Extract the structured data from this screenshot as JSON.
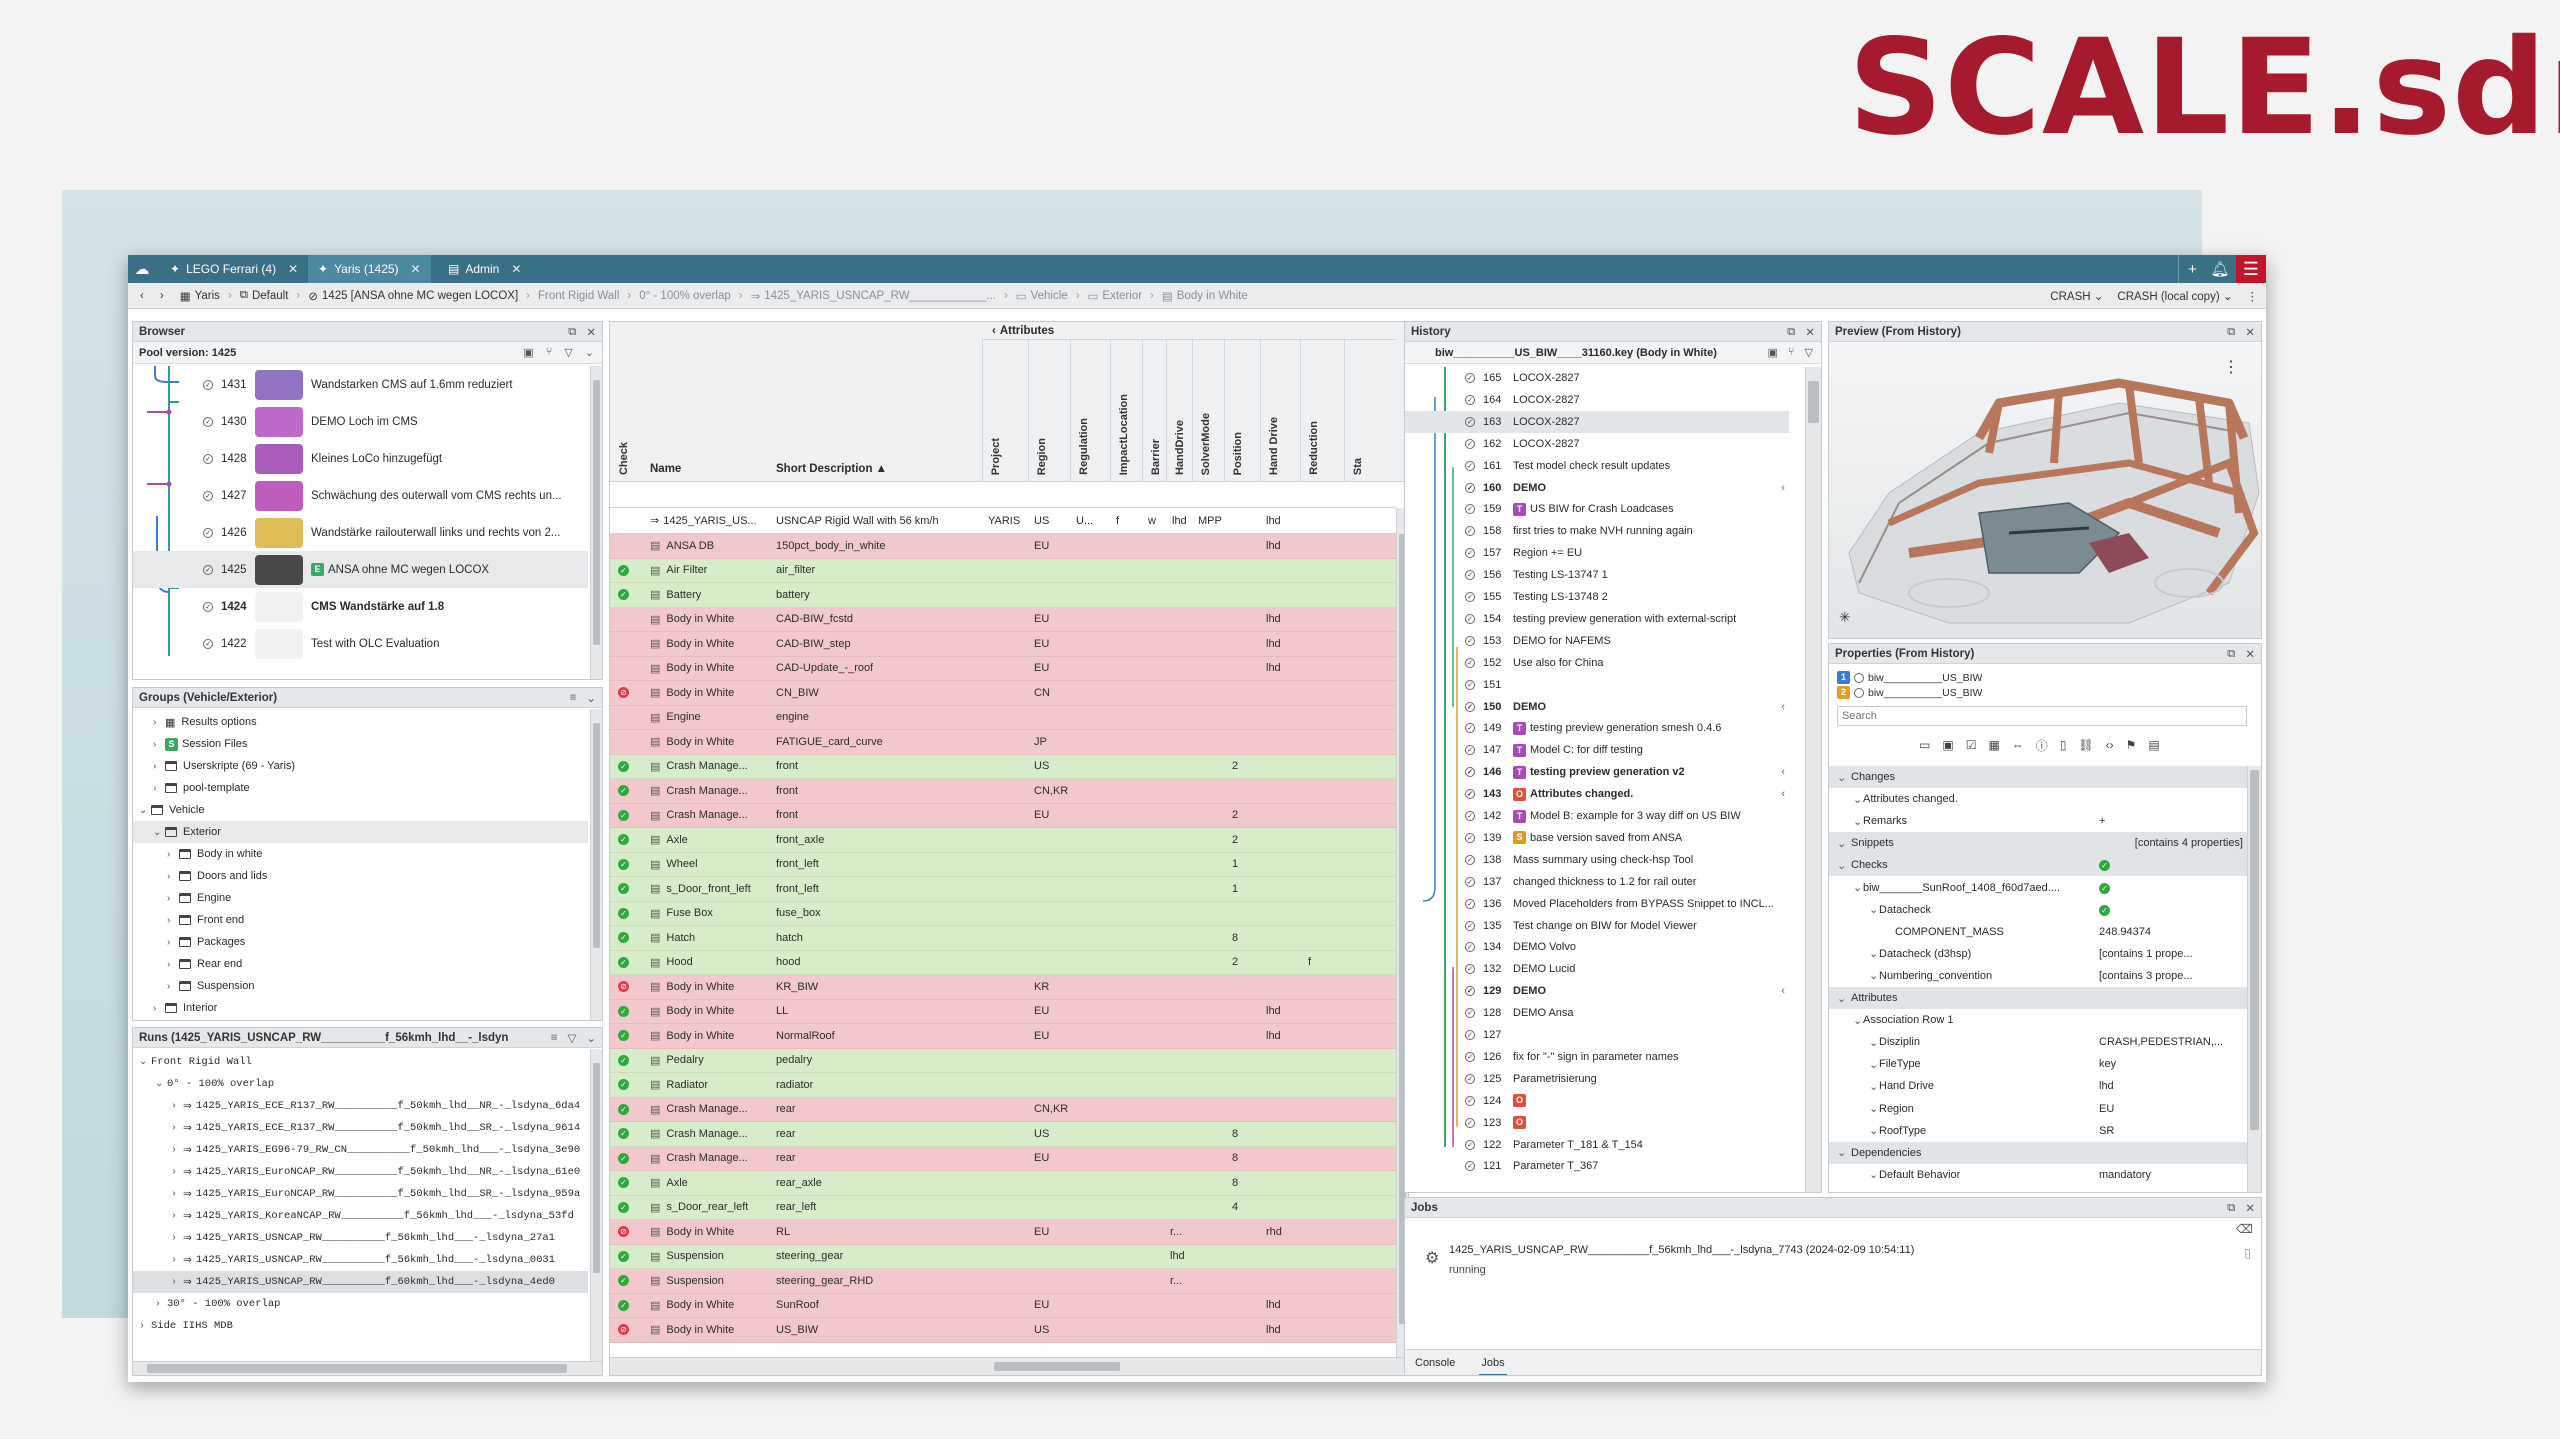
{
  "brand": {
    "logo_text": "SCALE.sdm",
    "color": "#a61a2e"
  },
  "titlebar": {
    "tabs": [
      {
        "label": "LEGO Ferrari (4)"
      },
      {
        "label": "Yaris (1425)"
      },
      {
        "label": "Admin"
      }
    ],
    "accent": "#3a6f88",
    "menu_color": "#c4142c"
  },
  "breadcrumb": {
    "items": [
      "Yaris",
      "Default",
      "1425 [ANSA ohne MC wegen LOCOX]",
      "Front Rigid Wall",
      "0° - 100% overlap",
      "1425_YARIS_USNCAP_RW____________...",
      "Vehicle",
      "Exterior",
      "Body in White"
    ],
    "right_items": [
      "CRASH",
      "CRASH (local copy)"
    ]
  },
  "browser": {
    "title": "Browser",
    "pool_version": "Pool version: 1425",
    "items": [
      {
        "id": "1431",
        "desc": "Wandstarken CMS auf 1.6mm reduziert"
      },
      {
        "id": "1430",
        "desc": "DEMO Loch im CMS"
      },
      {
        "id": "1428",
        "desc": "Kleines LoCo hinzugefügt"
      },
      {
        "id": "1427",
        "desc": "Schwächung des outerwall vom CMS rechts un..."
      },
      {
        "id": "1426",
        "desc": "Wandstärke railouterwall links und rechts von 2..."
      },
      {
        "id": "1425",
        "desc": "ANSA ohne MC wegen LOCOX",
        "badge": "E"
      },
      {
        "id": "1424",
        "desc": "CMS Wandstärke auf 1.8"
      },
      {
        "id": "1422",
        "desc": "Test with OLC Evaluation"
      }
    ]
  },
  "groups": {
    "title": "Groups (Vehicle/Exterior)",
    "items": [
      {
        "label": "Results options",
        "indent": 1
      },
      {
        "label": "Session Files",
        "indent": 1,
        "badge": "S"
      },
      {
        "label": "Userskripte (69 - Yaris)",
        "indent": 1
      },
      {
        "label": "pool-template",
        "indent": 1
      },
      {
        "label": "Vehicle",
        "indent": 0
      },
      {
        "label": "Exterior",
        "indent": 1
      },
      {
        "label": "Body in white",
        "indent": 2
      },
      {
        "label": "Doors and lids",
        "indent": 2
      },
      {
        "label": "Engine",
        "indent": 2
      },
      {
        "label": "Front end",
        "indent": 2
      },
      {
        "label": "Packages",
        "indent": 2
      },
      {
        "label": "Rear end",
        "indent": 2
      },
      {
        "label": "Suspension",
        "indent": 2
      },
      {
        "label": "Interior",
        "indent": 1
      }
    ]
  },
  "runs": {
    "title": "Runs (1425_YARIS_USNCAP_RW__________f_56kmh_lhd__-_lsdyna...",
    "items": [
      {
        "label": "Front Rigid Wall",
        "indent": 0
      },
      {
        "label": "0° - 100% overlap",
        "indent": 1
      },
      {
        "label": "1425_YARIS_ECE_R137_RW__________f_50kmh_lhd__NR_-_lsdyna_6da4",
        "indent": 2
      },
      {
        "label": "1425_YARIS_ECE_R137_RW__________f_50kmh_lhd__SR_-_lsdyna_9614",
        "indent": 2
      },
      {
        "label": "1425_YARIS_EG96-79_RW_CN__________f_50kmh_lhd___-_lsdyna_3e90",
        "indent": 2
      },
      {
        "label": "1425_YARIS_EuroNCAP_RW__________f_50kmh_lhd__NR_-_lsdyna_61e0",
        "indent": 2
      },
      {
        "label": "1425_YARIS_EuroNCAP_RW__________f_50kmh_lhd__SR_-_lsdyna_959a",
        "indent": 2
      },
      {
        "label": "1425_YARIS_KoreaNCAP_RW__________f_56kmh_lhd___-_lsdyna_53fd",
        "indent": 2
      },
      {
        "label": "1425_YARIS_USNCAP_RW__________f_56kmh_lhd___-_lsdyna_27a1",
        "indent": 2
      },
      {
        "label": "1425_YARIS_USNCAP_RW__________f_56kmh_lhd___-_lsdyna_0031",
        "indent": 2
      },
      {
        "label": "1425_YARIS_USNCAP_RW__________f_60kmh_lhd___-_lsdyna_4ed0",
        "indent": 2
      },
      {
        "label": "30° - 100% overlap",
        "indent": 1
      },
      {
        "label": "Side IIHS MDB",
        "indent": 0
      }
    ]
  },
  "table": {
    "attributes_header": "Attributes",
    "columns": {
      "check": "Check",
      "name": "Name",
      "short": "Short Description"
    },
    "attr_columns": [
      "Project",
      "Region",
      "Regulation",
      "ImpactLocation",
      "Barrier",
      "HandDrive",
      "SolverMode",
      "Position",
      "Hand Drive",
      "Reduction",
      "Sta"
    ],
    "top_row": {
      "name": "1425_YARIS_US...",
      "short": "USNCAP Rigid Wall with 56 km/h",
      "vals": [
        "YARIS",
        "US",
        "U...",
        "f",
        "w",
        "lhd",
        "MPP",
        "",
        "lhd",
        "",
        ""
      ]
    },
    "rows": [
      {
        "s": "r",
        "st": "",
        "name": "ANSA DB",
        "short": "150pct_body_in_white",
        "region": "EU",
        "pos": "",
        "hd": "lhd",
        "extra": ""
      },
      {
        "s": "g",
        "st": "ok",
        "name": "Air Filter",
        "short": "air_filter",
        "region": "",
        "pos": "",
        "hd": "",
        "extra": ""
      },
      {
        "s": "g",
        "st": "ok",
        "name": "Battery",
        "short": "battery",
        "region": "",
        "pos": "",
        "hd": "",
        "extra": ""
      },
      {
        "s": "r",
        "st": "",
        "name": "Body in White",
        "short": "CAD-BIW_fcstd",
        "region": "EU",
        "pos": "",
        "hd": "lhd",
        "extra": ""
      },
      {
        "s": "r",
        "st": "",
        "name": "Body in White",
        "short": "CAD-BIW_step",
        "region": "EU",
        "pos": "",
        "hd": "lhd",
        "extra": ""
      },
      {
        "s": "r",
        "st": "",
        "name": "Body in White",
        "short": "CAD-Update_-_roof",
        "region": "EU",
        "pos": "",
        "hd": "lhd",
        "extra": ""
      },
      {
        "s": "r",
        "st": "no",
        "name": "Body in White",
        "short": "CN_BIW",
        "region": "CN",
        "pos": "",
        "hd": "",
        "extra": ""
      },
      {
        "s": "r",
        "st": "",
        "name": "Engine",
        "short": "engine",
        "region": "",
        "pos": "",
        "hd": "",
        "extra": ""
      },
      {
        "s": "r",
        "st": "",
        "name": "Body in White",
        "short": "FATIGUE_card_curve",
        "region": "JP",
        "pos": "",
        "hd": "",
        "extra": ""
      },
      {
        "s": "g",
        "st": "ok",
        "name": "Crash Manage...",
        "short": "front",
        "region": "US",
        "pos": "2",
        "hd": "",
        "extra": ""
      },
      {
        "s": "r",
        "st": "ok",
        "name": "Crash Manage...",
        "short": "front",
        "region": "CN,KR",
        "pos": "",
        "hd": "",
        "extra": ""
      },
      {
        "s": "r",
        "st": "ok",
        "name": "Crash Manage...",
        "short": "front",
        "region": "EU",
        "pos": "2",
        "hd": "",
        "extra": ""
      },
      {
        "s": "g",
        "st": "ok",
        "name": "Axle",
        "short": "front_axle",
        "region": "",
        "pos": "2",
        "hd": "",
        "extra": ""
      },
      {
        "s": "g",
        "st": "ok",
        "name": "Wheel",
        "short": "front_left",
        "region": "",
        "pos": "1",
        "hd": "",
        "extra": ""
      },
      {
        "s": "g",
        "st": "ok",
        "name": "s_Door_front_left",
        "short": "front_left",
        "region": "",
        "pos": "1",
        "hd": "",
        "extra": ""
      },
      {
        "s": "g",
        "st": "ok",
        "name": "Fuse Box",
        "short": "fuse_box",
        "region": "",
        "pos": "",
        "hd": "",
        "extra": ""
      },
      {
        "s": "g",
        "st": "ok",
        "name": "Hatch",
        "short": "hatch",
        "region": "",
        "pos": "8",
        "hd": "",
        "extra": ""
      },
      {
        "s": "g",
        "st": "ok",
        "name": "Hood",
        "short": "hood",
        "region": "",
        "pos": "2",
        "hd": "",
        "extra": "f"
      },
      {
        "s": "r",
        "st": "no",
        "name": "Body in White",
        "short": "KR_BIW",
        "region": "KR",
        "pos": "",
        "hd": "",
        "extra": ""
      },
      {
        "s": "r",
        "st": "ok",
        "name": "Body in White",
        "short": "LL",
        "region": "EU",
        "pos": "",
        "hd": "lhd",
        "extra": ""
      },
      {
        "s": "r",
        "st": "ok",
        "name": "Body in White",
        "short": "NormalRoof",
        "region": "EU",
        "pos": "",
        "hd": "lhd",
        "extra": ""
      },
      {
        "s": "g",
        "st": "ok",
        "name": "Pedalry",
        "short": "pedalry",
        "region": "",
        "pos": "",
        "hd": "",
        "extra": ""
      },
      {
        "s": "g",
        "st": "ok",
        "name": "Radiator",
        "short": "radiator",
        "region": "",
        "pos": "",
        "hd": "",
        "extra": ""
      },
      {
        "s": "r",
        "st": "ok",
        "name": "Crash Manage...",
        "short": "rear",
        "region": "CN,KR",
        "pos": "",
        "hd": "",
        "extra": ""
      },
      {
        "s": "g",
        "st": "ok",
        "name": "Crash Manage...",
        "short": "rear",
        "region": "US",
        "pos": "8",
        "hd": "",
        "extra": ""
      },
      {
        "s": "r",
        "st": "ok",
        "name": "Crash Manage...",
        "short": "rear",
        "region": "EU",
        "pos": "8",
        "hd": "",
        "extra": ""
      },
      {
        "s": "g",
        "st": "ok",
        "name": "Axle",
        "short": "rear_axle",
        "region": "",
        "pos": "8",
        "hd": "",
        "extra": ""
      },
      {
        "s": "g",
        "st": "ok",
        "name": "s_Door_rear_left",
        "short": "rear_left",
        "region": "",
        "pos": "4",
        "hd": "",
        "extra": ""
      },
      {
        "s": "r",
        "st": "no",
        "name": "Body in White",
        "short": "RL",
        "region": "EU",
        "pos": "",
        "hd": "rhd",
        "extra": "",
        "handdrive": "r..."
      },
      {
        "s": "g",
        "st": "ok",
        "name": "Suspension",
        "short": "steering_gear",
        "region": "",
        "pos": "",
        "hd": "",
        "extra": "",
        "handdrive": "lhd"
      },
      {
        "s": "r",
        "st": "ok",
        "name": "Suspension",
        "short": "steering_gear_RHD",
        "region": "",
        "pos": "",
        "hd": "",
        "extra": "",
        "handdrive": "r..."
      },
      {
        "s": "r",
        "st": "ok",
        "name": "Body in White",
        "short": "SunRoof",
        "region": "EU",
        "pos": "",
        "hd": "lhd",
        "extra": ""
      },
      {
        "s": "r",
        "st": "no",
        "name": "Body in White",
        "short": "US_BIW",
        "region": "US",
        "pos": "",
        "hd": "lhd",
        "extra": ""
      }
    ]
  },
  "history": {
    "title": "History",
    "file": "biw__________US_BIW____31160.key (Body in White)",
    "rows": [
      {
        "id": "165",
        "text": "LOCOX-2827"
      },
      {
        "id": "164",
        "text": "LOCOX-2827"
      },
      {
        "id": "163",
        "text": "LOCOX-2827",
        "sel": true
      },
      {
        "id": "162",
        "text": "LOCOX-2827"
      },
      {
        "id": "161",
        "text": "Test model check result updates"
      },
      {
        "id": "160",
        "text": "DEMO",
        "bold": true
      },
      {
        "id": "159",
        "text": "US BIW for Crash Loadcases",
        "badge": "T",
        "bc": "#a64ab8"
      },
      {
        "id": "158",
        "text": "first tries to make NVH running again"
      },
      {
        "id": "157",
        "text": "Region += EU"
      },
      {
        "id": "156",
        "text": "Testing LS-13747 1"
      },
      {
        "id": "155",
        "text": "Testing LS-13748 2"
      },
      {
        "id": "154",
        "text": "testing preview generation with external-script"
      },
      {
        "id": "153",
        "text": "DEMO for NAFEMS"
      },
      {
        "id": "152",
        "text": "Use also for China"
      },
      {
        "id": "151",
        "text": ""
      },
      {
        "id": "150",
        "text": "DEMO",
        "bold": true
      },
      {
        "id": "149",
        "text": "testing preview generation smesh 0.4.6",
        "badge": "T",
        "bc": "#a64ab8"
      },
      {
        "id": "147",
        "text": "Model C: for diff testing",
        "badge": "T",
        "bc": "#a64ab8"
      },
      {
        "id": "146",
        "text": "testing preview generation v2",
        "bold": true,
        "badge": "T",
        "bc": "#a64ab8"
      },
      {
        "id": "143",
        "text": "Attributes changed.",
        "bold": true,
        "badge": "O",
        "bc": "#e0503a"
      },
      {
        "id": "142",
        "text": "Model B: example for 3 way diff on US BIW",
        "badge": "T",
        "bc": "#a64ab8"
      },
      {
        "id": "139",
        "text": "base version saved from ANSA",
        "badge": "S",
        "bc": "#e09a20"
      },
      {
        "id": "138",
        "text": "Mass summary using check-hsp Tool"
      },
      {
        "id": "137",
        "text": "changed thickness to 1.2 for rail outer"
      },
      {
        "id": "136",
        "text": "Moved Placeholders from BYPASS Snippet to INCL..."
      },
      {
        "id": "135",
        "text": "Test change on BIW for Model Viewer"
      },
      {
        "id": "134",
        "text": "DEMO Volvo"
      },
      {
        "id": "132",
        "text": "DEMO Lucid"
      },
      {
        "id": "129",
        "text": "DEMO",
        "bold": true
      },
      {
        "id": "128",
        "text": "DEMO Ansa"
      },
      {
        "id": "127",
        "text": ""
      },
      {
        "id": "126",
        "text": "fix for \"-\" sign in parameter names"
      },
      {
        "id": "125",
        "text": "Parametrisierung"
      },
      {
        "id": "124",
        "text": "",
        "badge": "O",
        "bc": "#e0503a"
      },
      {
        "id": "123",
        "text": "",
        "badge": "O",
        "bc": "#e0503a"
      },
      {
        "id": "122",
        "text": "Parameter T_181 & T_154"
      },
      {
        "id": "121",
        "text": "Parameter T_367"
      }
    ]
  },
  "preview": {
    "title": "Preview (From History)"
  },
  "properties": {
    "title": "Properties (From History)",
    "versions": [
      {
        "n": "1",
        "label": "biw__________US_BIW"
      },
      {
        "n": "2",
        "label": "biw__________US_BIW"
      }
    ],
    "search_placeholder": "Search",
    "rows": [
      {
        "label": "Changes",
        "val": "",
        "sec": true,
        "indent": 0
      },
      {
        "label": "Attributes changed.",
        "val": "",
        "indent": 1
      },
      {
        "label": "Remarks",
        "val": "+",
        "indent": 1
      },
      {
        "label": "Snippets",
        "val": "[contains 4 properties]",
        "sec": true,
        "indent": 0
      },
      {
        "label": "Checks",
        "val": "ok",
        "sec": true,
        "indent": 0
      },
      {
        "label": "biw_______SunRoof_1408_f60d7aed....",
        "val": "ok",
        "indent": 1
      },
      {
        "label": "Datacheck",
        "val": "ok",
        "indent": 2
      },
      {
        "label": "COMPONENT_MASS",
        "val": "248.94374",
        "indent": 3
      },
      {
        "label": "Datacheck (d3hsp)",
        "val": "[contains 1 prope...",
        "indent": 2
      },
      {
        "label": "Numbering_convention",
        "val": "[contains 3 prope...",
        "indent": 2
      },
      {
        "label": "Attributes",
        "val": "",
        "sec": true,
        "indent": 0
      },
      {
        "label": "Association Row 1",
        "val": "",
        "indent": 1
      },
      {
        "label": "Disziplin",
        "val": "CRASH,PEDESTRIAN,...",
        "indent": 2
      },
      {
        "label": "FileType",
        "val": "key",
        "indent": 2
      },
      {
        "label": "Hand Drive",
        "val": "lhd",
        "indent": 2
      },
      {
        "label": "Region",
        "val": "EU",
        "indent": 2
      },
      {
        "label": "RoofType",
        "val": "SR",
        "indent": 2
      },
      {
        "label": "Dependencies",
        "val": "",
        "sec": true,
        "indent": 0
      },
      {
        "label": "Default Behavior",
        "val": "mandatory",
        "indent": 2
      }
    ]
  },
  "jobs": {
    "title": "Jobs",
    "job_name": "1425_YARIS_USNCAP_RW__________f_56kmh_lhd___-_lsdyna_7743 (2024-02-09 10:54:11)",
    "status": "running",
    "tabs": [
      "Console",
      "Jobs"
    ]
  }
}
